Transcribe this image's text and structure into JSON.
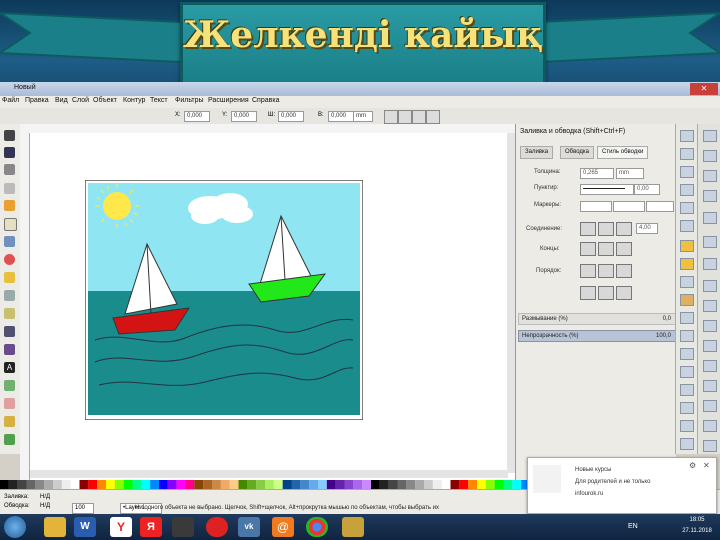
{
  "slide": {
    "title": "Желкенді кайық"
  },
  "window": {
    "title": "Новый",
    "close_icon": "close-icon"
  },
  "menu": [
    "Файл",
    "Правка",
    "Вид",
    "Слой",
    "Объект",
    "Контур",
    "Текст",
    "Фильтры",
    "Расширения",
    "Справка"
  ],
  "toolbar": {
    "x_label": "X:",
    "x_value": "0,000",
    "y_label": "Y:",
    "y_value": "0,000",
    "w_label": "Ш:",
    "w_value": "0,000",
    "h_label": "В:",
    "h_value": "0,000",
    "unit": "mm"
  },
  "dialog": {
    "title": "Заливка и обводка (Shift+Ctrl+F)",
    "tabs": [
      "Заливка",
      "Обводка",
      "Стиль обводки"
    ],
    "width_label": "Толщина:",
    "width_value": "0,265",
    "width_unit": "mm",
    "dashes_label": "Пунктир:",
    "dashes_value": "0,00",
    "markers_label": "Маркеры:",
    "join_label": "Соединение:",
    "miter_value": "4,00",
    "cap_label": "Концы:",
    "order_label": "Порядок:",
    "blur_label": "Размывание (%)",
    "blur_value": "0,0",
    "opacity_label": "Непрозрачность (%)",
    "opacity_value": "100,0"
  },
  "status": {
    "fill_label": "Заливка:",
    "fill_value": "Н/Д",
    "stroke_label": "Обводка:",
    "stroke_value": "Н/Д",
    "opacity_value": "100",
    "layer": "•Layer 1",
    "message": "Ни одного объекта не выбрано. Щелчок, Shift+щелчок, Alt+прокрутка мышью по объектам, чтобы выбрать их"
  },
  "notification": {
    "line1": "Новые курсы",
    "line2": "Для родителей и не только",
    "line3": "infourok.ru"
  },
  "taskbar": {
    "lang": "EN",
    "time": "18:05",
    "date": "27.11.2018"
  },
  "colors": {
    "banner": "#1a7f88",
    "title_text": "#f6e27a",
    "sky": "#8fe6f2",
    "sea": "#1a8c8c",
    "red_boat": "#d41414",
    "green_boat": "#22e81a",
    "sun": "#ffe84a"
  }
}
